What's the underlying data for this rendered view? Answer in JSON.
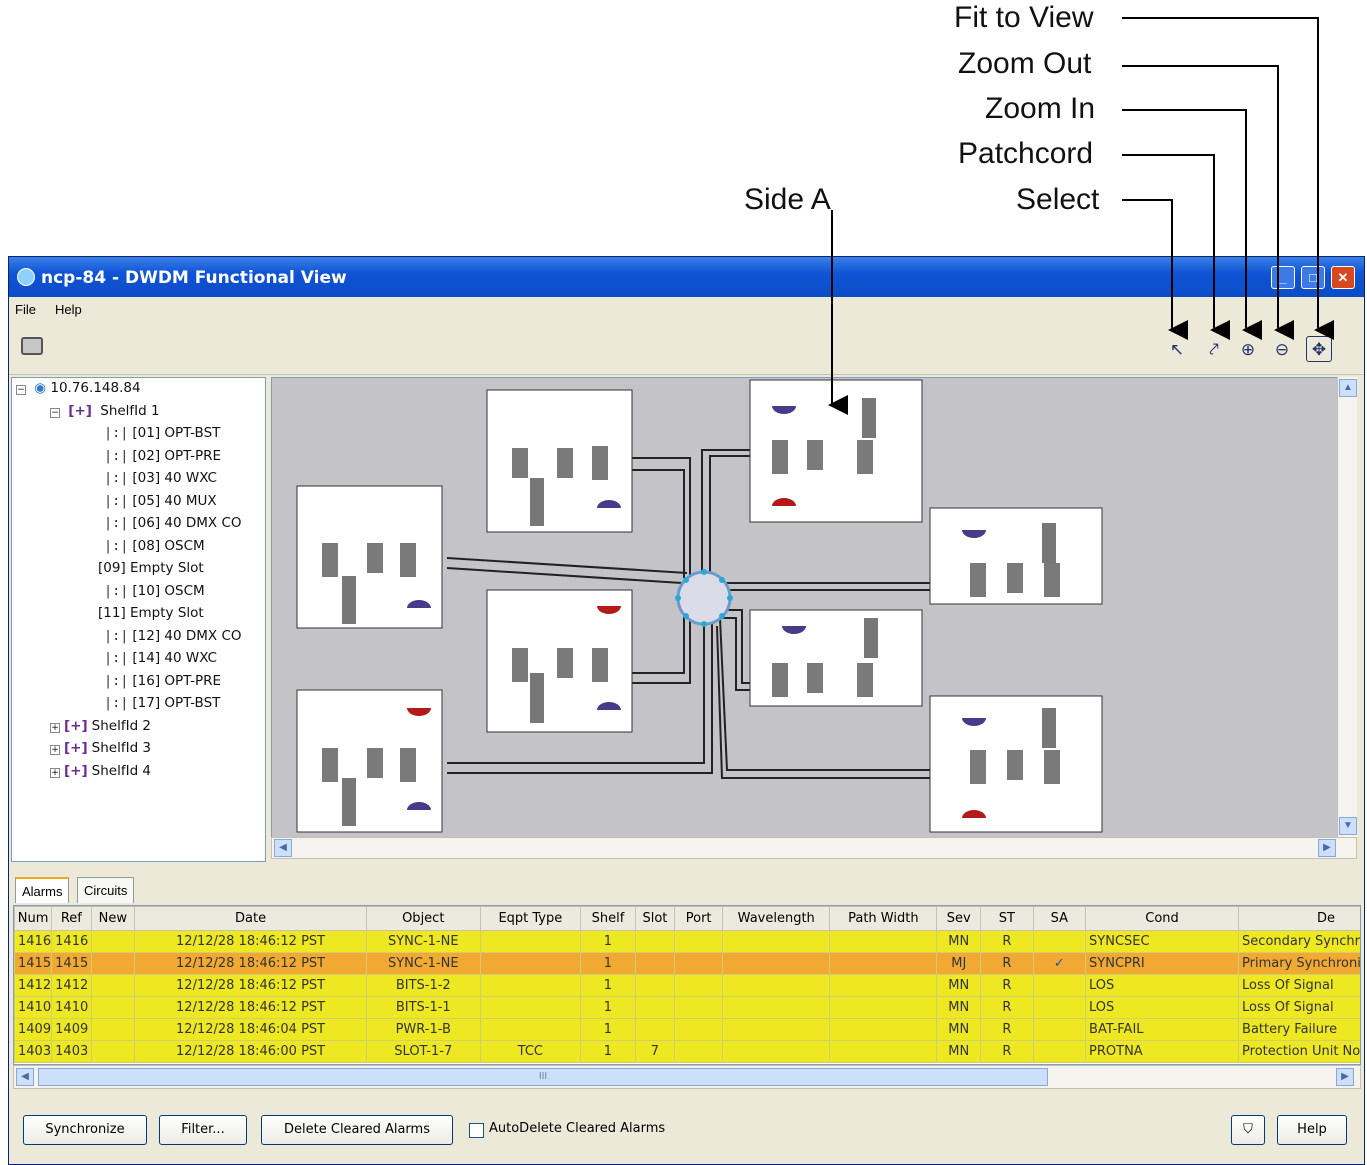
{
  "callouts": {
    "fit_to_view": "Fit to View",
    "zoom_out": "Zoom Out",
    "zoom_in": "Zoom In",
    "patchcord": "Patchcord",
    "select": "Select",
    "side_a": "Side A"
  },
  "window": {
    "title": "ncp-84 - DWDM Functional View",
    "menu": [
      "File",
      "Help"
    ]
  },
  "toolbar": {
    "icons": [
      "select-icon",
      "patchcord-icon",
      "zoom-in-icon",
      "zoom-out-icon",
      "fit-to-view-icon"
    ]
  },
  "tree": {
    "root": "10.76.148.84",
    "shelf1": "ShelfId 1",
    "cards": [
      "[01] OPT-BST",
      "[02] OPT-PRE",
      "[03] 40 WXC",
      "[05] 40 MUX",
      "[06] 40 DMX CO",
      "[08] OSCM",
      "[09] Empty Slot",
      "[10] OSCM",
      "[11] Empty Slot",
      "[12] 40 DMX CO",
      "[14] 40 WXC",
      "[16] OPT-PRE",
      "[17] OPT-BST"
    ],
    "other_shelves": [
      "ShelfId 2",
      "ShelfId 3",
      "ShelfId 4"
    ]
  },
  "tabs": [
    "Alarms",
    "Circuits"
  ],
  "alarms": {
    "columns": [
      "Num",
      "Ref",
      "New",
      "Date",
      "Object",
      "Eqpt Type",
      "Shelf",
      "Slot",
      "Port",
      "Wavelength",
      "Path Width",
      "Sev",
      "ST",
      "SA",
      "Cond",
      "De"
    ],
    "rows": [
      [
        "1416",
        "1416",
        "",
        "12/12/28 18:46:12 PST",
        "SYNC-1-NE",
        "",
        "1",
        "",
        "",
        "",
        "",
        "MN",
        "R",
        "",
        "SYNCSEC",
        "Secondary Synchroniz"
      ],
      [
        "1415",
        "1415",
        "",
        "12/12/28 18:46:12 PST",
        "SYNC-1-NE",
        "",
        "1",
        "",
        "",
        "",
        "",
        "MJ",
        "R",
        "✓",
        "SYNCPRI",
        "Primary Synchronizati"
      ],
      [
        "1412",
        "1412",
        "",
        "12/12/28 18:46:12 PST",
        "BITS-1-2",
        "",
        "1",
        "",
        "",
        "",
        "",
        "MN",
        "R",
        "",
        "LOS",
        "Loss Of Signal"
      ],
      [
        "1410",
        "1410",
        "",
        "12/12/28 18:46:12 PST",
        "BITS-1-1",
        "",
        "1",
        "",
        "",
        "",
        "",
        "MN",
        "R",
        "",
        "LOS",
        "Loss Of Signal"
      ],
      [
        "1409",
        "1409",
        "",
        "12/12/28 18:46:04 PST",
        "PWR-1-B",
        "",
        "1",
        "",
        "",
        "",
        "",
        "MN",
        "R",
        "",
        "BAT-FAIL",
        "Battery Failure"
      ],
      [
        "1403",
        "1403",
        "",
        "12/12/28 18:46:00 PST",
        "SLOT-1-7",
        "TCC",
        "1",
        "7",
        "",
        "",
        "",
        "MN",
        "R",
        "",
        "PROTNA",
        "Protection Unit Not Av"
      ]
    ],
    "scroll_label": "III"
  },
  "buttons": {
    "synchronize": "Synchronize",
    "filter": "Filter...",
    "delete_cleared": "Delete Cleared Alarms",
    "autodelete": "AutoDelete Cleared Alarms",
    "help": "Help"
  }
}
